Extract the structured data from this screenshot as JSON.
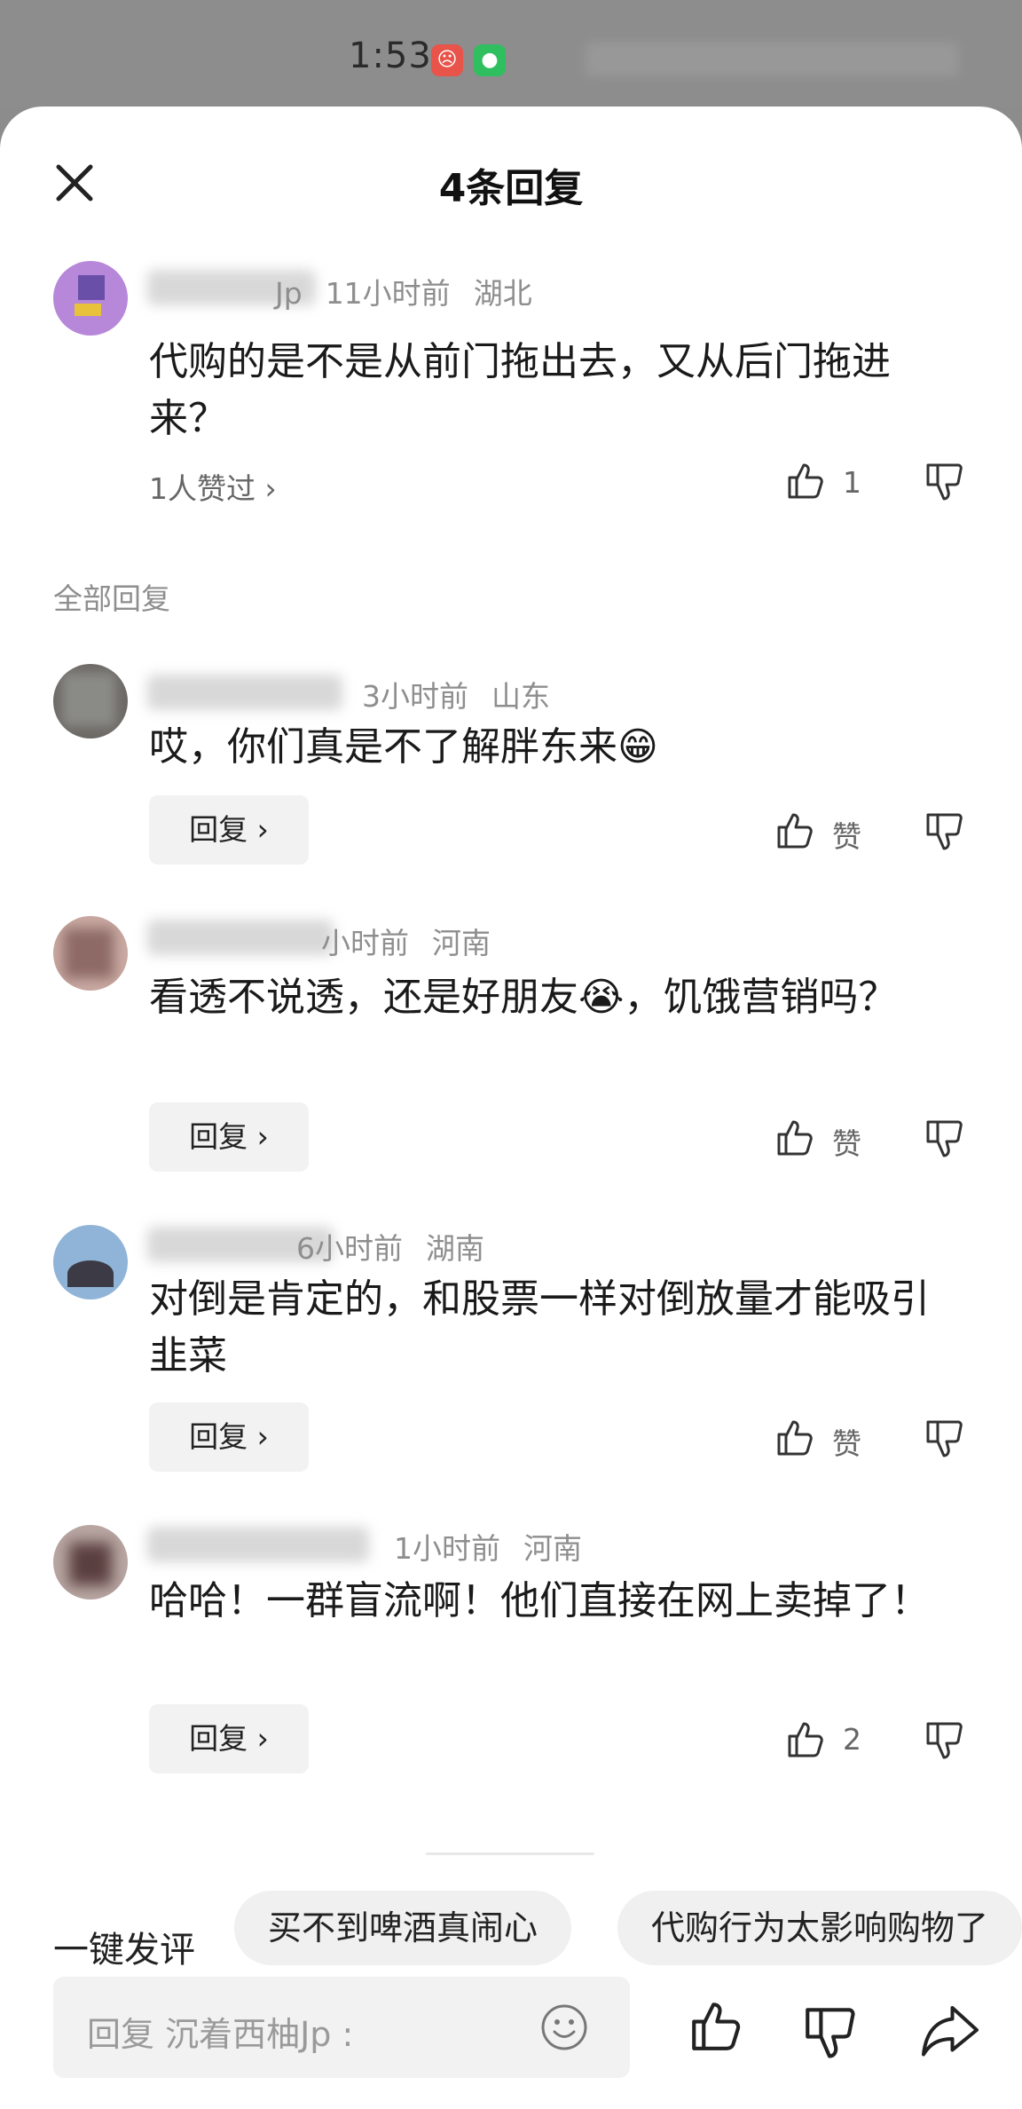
{
  "status_bar": {
    "time": "1:53"
  },
  "header": {
    "title": "4条回复"
  },
  "main_comment": {
    "time": "11小时前",
    "location": "湖北",
    "user_suffix": "Jp",
    "text": "代购的是不是从前门拖出去，又从后门拖进来？",
    "likes_summary": "1人赞过 ›",
    "like_count": "1"
  },
  "section_label": "全部回复",
  "replies": [
    {
      "time": "3小时前",
      "location": "山东",
      "text": "哎，你们真是不了解胖东来😁",
      "like_label": "赞",
      "reply_label": "回复 ›"
    },
    {
      "time": "小时前",
      "location": "河南",
      "text": "看透不说透，还是好朋友😭，饥饿营销吗？",
      "like_label": "赞",
      "reply_label": "回复 ›"
    },
    {
      "time": "6小时前",
      "location": "湖南",
      "text": "对倒是肯定的，和股票一样对倒放量才能吸引韭菜",
      "like_label": "赞",
      "reply_label": "回复 ›"
    },
    {
      "time": "1小时前",
      "location": "河南",
      "text": "哈哈！一群盲流啊！他们直接在网上卖掉了！",
      "like_label": "2",
      "reply_label": "回复 ›"
    }
  ],
  "quick_comment": {
    "label": "一键发评",
    "chips": [
      "买不到啤酒真闹心",
      "代购行为太影响购物了"
    ]
  },
  "input": {
    "placeholder": "回复 沉着西柚Jp :"
  },
  "colors": {
    "accent_text": "#1a1a1a",
    "muted": "#8e8e8e",
    "chip_bg": "#f0f0f0"
  }
}
